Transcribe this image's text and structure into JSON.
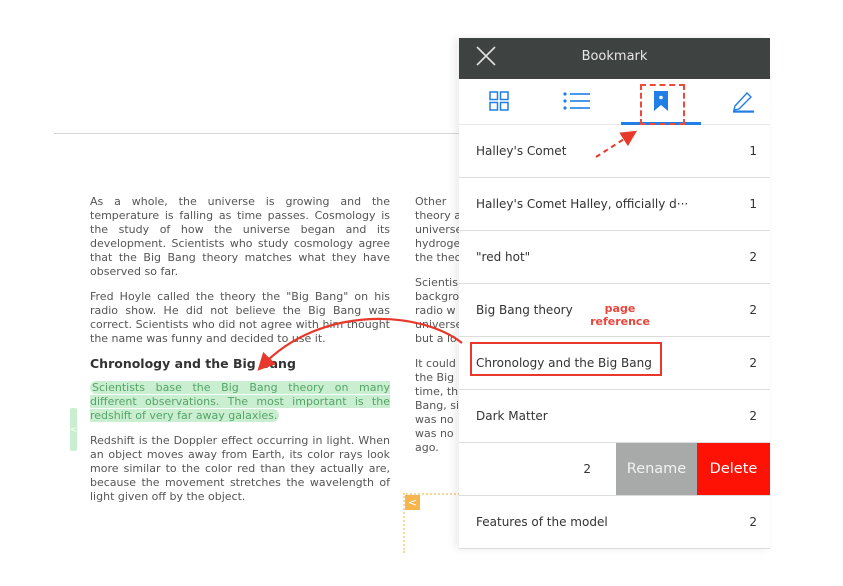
{
  "book": {
    "left_column": {
      "paragraphs": [
        "As a whole, the universe is growing and the temperature is falling as time passes. Cosmology is the study of how the universe began and its development. Scientists who study cosmology agree that the Big Bang theory matches what they have observed so far.",
        "Fred Hoyle called the theory the \"Big Bang\" on his radio show. He did not believe the Big Bang was correct. Scientists who did not agree with him thought the name was funny and decided to use it."
      ],
      "heading": "Chronology and the Big Bang",
      "highlighted": "Scientists base the Big Bang theory on many different observations. The most important is the redshift of very far away galaxies.",
      "last_paragraph": "Redshift is the Doppler effect occurring in light. When an object moves away from Earth, its color rays look more similar to the color red than they actually are, because the movement stretches the wavelength of light given off by the object."
    },
    "right_column": {
      "lines_a": [
        "Other",
        "theory a",
        "universe",
        "hydroge",
        "the theo"
      ],
      "lines_b": [
        "Scientis",
        "backgro",
        "radio w",
        "universe",
        "but a lo"
      ],
      "lines_c": [
        "It could",
        "the Big",
        "time, th",
        "Bang, si",
        "was no",
        "was no",
        "ago."
      ]
    },
    "highlight_color": "#c9efd0",
    "handle_glyph": "<",
    "collapse_glyph": "<"
  },
  "panel": {
    "title": "Bookmark",
    "close_icon": "close-icon",
    "tabs": [
      {
        "icon": "grid-icon",
        "label": "Thumbnails"
      },
      {
        "icon": "list-icon",
        "label": "Contents"
      },
      {
        "icon": "bookmark-icon",
        "label": "Bookmark",
        "active": true
      },
      {
        "icon": "pencil-icon",
        "label": "Notes"
      }
    ],
    "accent_color": "#1f7fe6",
    "bookmarks": [
      {
        "label": "Halley's Comet",
        "page": "1"
      },
      {
        "label": "Halley's Comet Halley, officially d···",
        "page": "1"
      },
      {
        "label": "\"red hot\"",
        "page": "2"
      },
      {
        "label": "Big Bang theory",
        "page": "2"
      },
      {
        "label": "Chronology and the Big Bang",
        "page": "2"
      },
      {
        "label": "Dark Matter",
        "page": "2"
      }
    ],
    "swiped_item": {
      "page": "2",
      "rename_label": "Rename",
      "delete_label": "Delete"
    },
    "last_item": {
      "label": "Features of the model",
      "page": "2"
    }
  },
  "annotation": {
    "callout_text_1": "page",
    "callout_text_2": "reference",
    "color": "#e8382b"
  }
}
